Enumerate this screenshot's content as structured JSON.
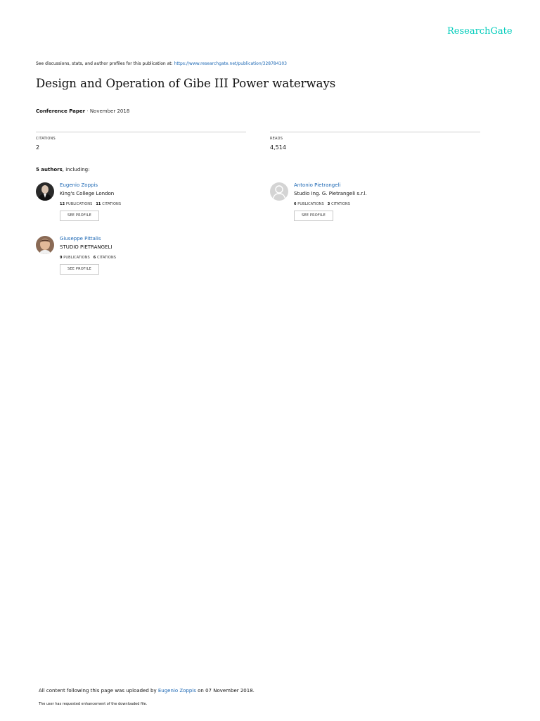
{
  "header": {
    "brand": "ResearchGate",
    "discuss_text": "See discussions, stats, and author profiles for this publication at: ",
    "discuss_url": "https://www.researchgate.net/publication/328784103"
  },
  "publication": {
    "title": "Design and Operation of Gibe III Power waterways",
    "type": "Conference Paper",
    "date_sep": " · ",
    "date": "November 2018"
  },
  "stats": {
    "citations_label": "CITATIONS",
    "citations_value": "2",
    "reads_label": "READS",
    "reads_value": "4,514"
  },
  "authors_header": {
    "count": "5 authors",
    "suffix": ", including:"
  },
  "authors": [
    {
      "name": "Eugenio Zoppis",
      "institution": "King's College London",
      "publications": "12",
      "publications_label": "PUBLICATIONS",
      "citations": "11",
      "citations_label": "CITATIONS",
      "button": "SEE PROFILE",
      "avatar_icon": "photo-avatar-dark"
    },
    {
      "name": "Antonio Pietrangeli",
      "institution": "Studio Ing. G. Pietrangeli s.r.l.",
      "publications": "6",
      "publications_label": "PUBLICATIONS",
      "citations": "3",
      "citations_label": "CITATIONS",
      "button": "SEE PROFILE",
      "avatar_icon": "default-avatar-icon"
    },
    {
      "name": "Giuseppe Pittalis",
      "institution": "STUDIO PIETRANGELI",
      "publications": "9",
      "publications_label": "PUBLICATIONS",
      "citations": "6",
      "citations_label": "CITATIONS",
      "button": "SEE PROFILE",
      "avatar_icon": "photo-avatar-light"
    }
  ],
  "footer": {
    "uploaded_prefix": "All content following this page was uploaded by ",
    "uploader": "Eugenio Zoppis",
    "uploaded_suffix": " on 07 November 2018.",
    "note": "The user has requested enhancement of the downloaded file."
  },
  "colors": {
    "brand": "#00ccbb",
    "link": "#1a66b3"
  }
}
